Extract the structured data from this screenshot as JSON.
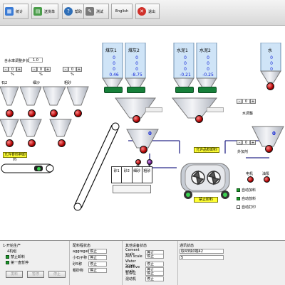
{
  "toolbar": {
    "buttons": [
      {
        "label": "统计",
        "icon": "chart-icon",
        "color": "#3a7bd5"
      },
      {
        "label": "送货单",
        "icon": "document-icon",
        "color": "#4a9d4a"
      },
      {
        "label": "帮助",
        "icon": "help-icon",
        "color": "#2f6fb8"
      },
      {
        "label": "测试",
        "icon": "wrench-icon",
        "color": "#7a7a7a"
      },
      {
        "label": "English",
        "icon": "",
        "color": ""
      },
      {
        "label": "退出",
        "icon": "close-icon",
        "color": "#d0302a"
      }
    ]
  },
  "aggregate": {
    "coarse_adjust_label": "含水率调整步长:",
    "coarse_adjust_value": "1.0",
    "pct_values": [
      "0 %",
      "0 %",
      "0 %"
    ],
    "bins": [
      {
        "label": "石2"
      },
      {
        "label": "细沙"
      },
      {
        "label": "粗砂"
      }
    ],
    "belt_label": "允许骨料秤卸料"
  },
  "powder": {
    "silos": [
      {
        "label": "煤灰1",
        "values": [
          "0",
          "0",
          "0"
        ],
        "weight": "0.46"
      },
      {
        "label": "煤灰2",
        "values": [
          "0",
          "0",
          "0"
        ],
        "weight": "-8.75"
      },
      {
        "label": "水泥1",
        "values": [
          "0",
          "0",
          "0"
        ],
        "weight": "-0.21"
      },
      {
        "label": "水泥2",
        "values": [
          "0",
          "0",
          "0"
        ],
        "weight": "-0.25"
      }
    ],
    "scale_value": "0",
    "discharge_label": "允许品粉卸料"
  },
  "water": {
    "silo_label": "水",
    "silo_values": [
      "0",
      "0",
      "0"
    ],
    "adjust_label": "水调整",
    "adjust_value": "0",
    "scale_value": "0",
    "agent_label": "外加剂",
    "agent_value": "0"
  },
  "mixer": {
    "scale_value": "0",
    "label_on": "开",
    "label_off": "关",
    "small_bins": [
      "砂1",
      "砂2",
      "细砂",
      "粗砂"
    ],
    "discharge_btn": "禁止卸料",
    "motor_label": "电机",
    "oil_label": "油泵",
    "auto_cb": [
      {
        "label": "自动加料",
        "checked": true
      },
      {
        "label": "自动放料",
        "checked": true
      },
      {
        "label": "自动打印",
        "checked": false
      }
    ]
  },
  "bottom": {
    "production": {
      "title": "1-开始生产",
      "mode": "4机组",
      "options": [
        {
          "label": "禁止卸料",
          "checked": true
        },
        {
          "label": "第一盘暂停",
          "checked": true
        }
      ],
      "buttons": [
        "发料",
        "暂停",
        "停止"
      ]
    },
    "batching": {
      "title": "配料程状态",
      "rows": [
        {
          "label": "aggregate",
          "value": "停止"
        },
        {
          "label": "小石子称",
          "value": "停止"
        },
        {
          "label": "砂5称",
          "value": "停止"
        },
        {
          "label": "粗砂称",
          "value": "停止"
        }
      ]
    },
    "equipment": {
      "title": "其他设备状态",
      "rows": [
        {
          "label": "Cement scale",
          "value": "停止"
        },
        {
          "label": "Ash scale",
          "value": "停止"
        },
        {
          "label": "Water Scale",
          "value": "停止"
        },
        {
          "label": "additive scale",
          "value": "停止"
        },
        {
          "label": "暂停位",
          "value": "停止"
        },
        {
          "label": "混动机",
          "value": "停止"
        }
      ]
    },
    "comm": {
      "title": "通讯状态",
      "line1": "取43缺0端42",
      "line2": "5"
    }
  }
}
